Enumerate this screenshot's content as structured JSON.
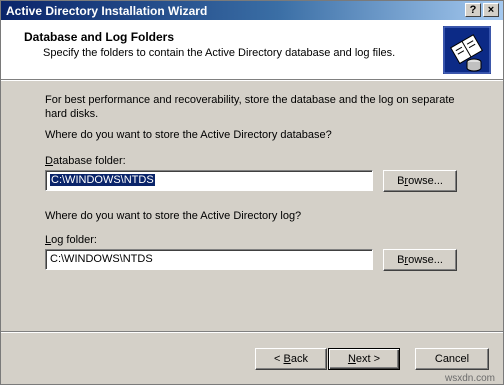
{
  "window": {
    "title": "Active Directory Installation Wizard",
    "help_label": "?",
    "close_label": "×"
  },
  "header": {
    "title": "Database and Log Folders",
    "subtitle": "Specify the folders to contain the Active Directory database and log files.",
    "icon": "database-book-icon"
  },
  "body": {
    "intro_line1": "For best performance and recoverability, store the database and the log on separate",
    "intro_line2": "hard disks.",
    "db_question": "Where do you want to store the Active Directory database?",
    "db_label_accel": "D",
    "db_label_rest": "atabase folder:",
    "db_value": "C:\\WINDOWS\\NTDS",
    "db_browse_accel": "r",
    "db_browse_pre": "B",
    "db_browse_post": "owse...",
    "log_question": "Where do you want to store the Active Directory log?",
    "log_label_accel": "L",
    "log_label_rest": "og folder:",
    "log_value": "C:\\WINDOWS\\NTDS",
    "log_browse_pre": "B",
    "log_browse_accel": "r",
    "log_browse_post": "owse..."
  },
  "footer": {
    "back_pre": "< ",
    "back_accel": "B",
    "back_post": "ack",
    "next_accel": "N",
    "next_post": "ext >",
    "cancel_label": "Cancel"
  },
  "watermark": "wsxdn.com",
  "colors": {
    "title_bar": "#0a246a",
    "face": "#d4d0c8",
    "selection": "#0a246a"
  }
}
